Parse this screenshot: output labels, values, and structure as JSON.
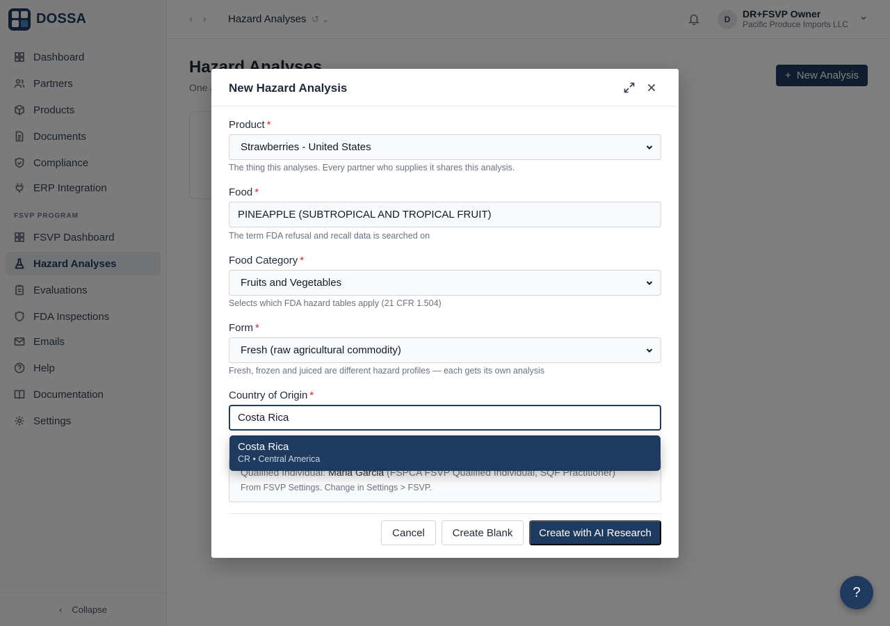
{
  "app": {
    "name": "DOSSA"
  },
  "sidebar": {
    "items": [
      {
        "label": "Dashboard",
        "icon": "grid-icon"
      },
      {
        "label": "Partners",
        "icon": "users-icon"
      },
      {
        "label": "Products",
        "icon": "box-icon"
      },
      {
        "label": "Documents",
        "icon": "document-icon"
      },
      {
        "label": "Compliance",
        "icon": "shield-check-icon"
      },
      {
        "label": "ERP Integration",
        "icon": "plug-icon"
      }
    ],
    "section_label": "FSVP PROGRAM",
    "fsvp_items": [
      {
        "label": "FSVP Dashboard",
        "icon": "grid-icon"
      },
      {
        "label": "Hazard Analyses",
        "icon": "flask-icon",
        "active": true
      },
      {
        "label": "Evaluations",
        "icon": "clipboard-icon"
      },
      {
        "label": "FDA Inspections",
        "icon": "shield-icon"
      },
      {
        "label": "Emails",
        "icon": "mail-icon"
      },
      {
        "label": "Help",
        "icon": "help-circle-icon"
      },
      {
        "label": "Documentation",
        "icon": "book-icon"
      },
      {
        "label": "Settings",
        "icon": "gear-icon"
      }
    ],
    "collapse_label": "Collapse"
  },
  "topbar": {
    "breadcrumb": "Hazard Analyses",
    "user_initial": "D",
    "user_name": "DR+FSVP Owner",
    "user_org": "Pacific Produce Imports LLC"
  },
  "page": {
    "title": "Hazard Analyses",
    "subtitle": "One a",
    "new_button": "New Analysis"
  },
  "modal": {
    "title": "New Hazard Analysis",
    "product": {
      "label": "Product",
      "value": "Strawberries - United States",
      "hint": "The thing this analyses. Every partner who supplies it shares this analysis."
    },
    "food": {
      "label": "Food",
      "value": "PINEAPPLE (SUBTROPICAL AND TROPICAL FRUIT)",
      "hint": "The term FDA refusal and recall data is searched on"
    },
    "food_category": {
      "label": "Food Category",
      "value": "Fruits and Vegetables",
      "hint": "Selects which FDA hazard tables apply (21 CFR 1.504)"
    },
    "form": {
      "label": "Form",
      "value": "Fresh (raw agricultural commodity)",
      "hint": "Fresh, frozen and juiced are different hazard profiles — each gets its own analysis"
    },
    "country": {
      "label": "Country of Origin",
      "value": "Costa Rica"
    },
    "dropdown": {
      "name": "Costa Rica",
      "meta": "CR • Central America"
    },
    "qualified_individual": {
      "prefix": "Qualified Individual:",
      "name": "Maria Garcia",
      "credentials": "(FSPCA FSVP Qualified Individual, SQF Practitioner)",
      "note": "From FSVP Settings. Change in Settings > FSVP."
    },
    "buttons": {
      "cancel": "Cancel",
      "create_blank": "Create Blank",
      "create_ai": "Create with AI Research"
    }
  },
  "help_fab": "?",
  "colors": {
    "brand": "#1e3a5f",
    "required": "#dc2626"
  }
}
